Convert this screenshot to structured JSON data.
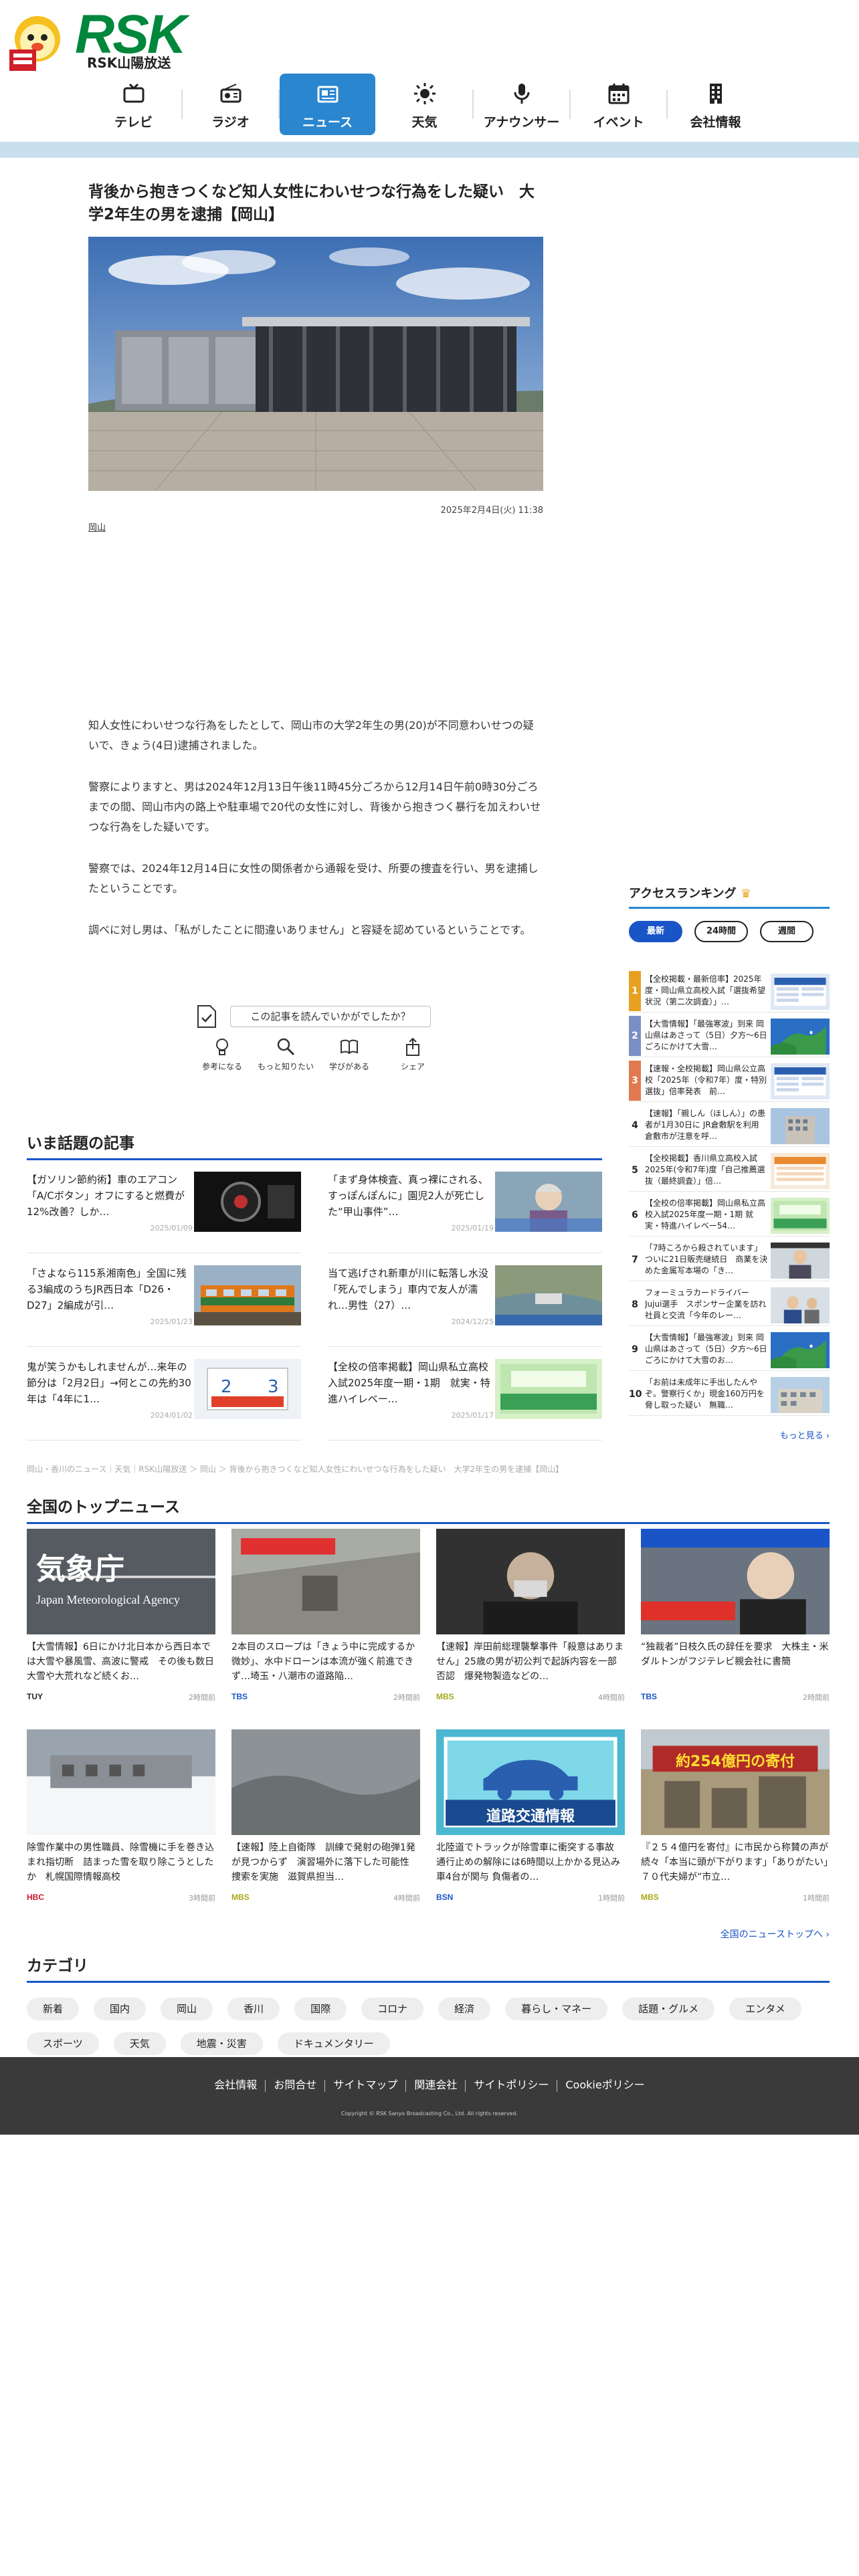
{
  "header": {
    "logo_text": "RSK",
    "logo_sub": "RSK山陽放送",
    "nav": [
      {
        "label": "テレビ",
        "icon": "tv-icon"
      },
      {
        "label": "ラジオ",
        "icon": "radio-icon"
      },
      {
        "label": "ニュース",
        "icon": "news-icon",
        "active": true
      },
      {
        "label": "天気",
        "icon": "sun-icon"
      },
      {
        "label": "アナウンサー",
        "icon": "microphone-icon"
      },
      {
        "label": "イベント",
        "icon": "calendar-icon"
      },
      {
        "label": "会社情報",
        "icon": "building-icon"
      }
    ]
  },
  "article": {
    "title": "背後から抱きつくなど知人女性にわいせつな行為をした疑い　大学2年生の男を逮捕【岡山】",
    "date": "2025年2月4日(火) 11:38",
    "tag": "岡山",
    "paragraphs": [
      "知人女性にわいせつな行為をしたとして、岡山市の大学2年生の男(20)が不同意わいせつの疑いで、きょう(4日)逮捕されました。",
      "警察によりますと、男は2024年12月13日午後11時45分ごろから12月14日午前0時30分ごろまでの間、岡山市内の路上や駐車場で20代の女性に対し、背後から抱きつく暴行を加えわいせつな行為をした疑いです。",
      "警察では、2024年12月14日に女性の関係者から通報を受け、所要の捜査を行い、男を逮捕したということです。",
      "調べに対し男は、「私がしたことに間違いありません」と容疑を認めているということです。"
    ],
    "feedback": {
      "question": "この記事を読んでいかがでしたか？",
      "options": [
        {
          "label": "参考になる",
          "icon": "lightbulb-icon"
        },
        {
          "label": "もっと知りたい",
          "icon": "magnifier-icon"
        },
        {
          "label": "学びがある",
          "icon": "book-icon"
        },
        {
          "label": "シェア",
          "icon": "share-icon"
        }
      ]
    }
  },
  "ranking": {
    "title": "アクセスランキング",
    "tabs": [
      "最新",
      "24時間",
      "週間"
    ],
    "active_tab": "最新",
    "items": [
      {
        "rank": "1",
        "text": "【全校掲載・最新倍率】2025年度・岡山県立高校入試「選抜希望状況（第二次調査）」…",
        "color": "#e8a020",
        "thumb": "blue-board"
      },
      {
        "rank": "2",
        "text": "【大雪情報】「最強寒波」到来 岡山県はあさって（5日）夕方〜6日ごろにかけて大雪…",
        "color": "#7b8fc4",
        "thumb": "map"
      },
      {
        "rank": "3",
        "text": "【速報・全校掲載】岡山県公立高校「2025年（令和7年）度・特別選抜」倍率発表　前…",
        "color": "#e07a50",
        "thumb": "blue-board"
      },
      {
        "rank": "4",
        "text": "【速報】「親しん（ほしん）」の患者が1月30日に JR倉敷駅を利用　倉敷市が注意を呼…",
        "color": "#ffffff",
        "thumb": "building"
      },
      {
        "rank": "5",
        "text": "【全校掲載】香川県立高校入試2025年(令和7年)度「自己推薦選抜（最終調査）」倍…",
        "color": "#ffffff",
        "thumb": "orange-board"
      },
      {
        "rank": "6",
        "text": "【全校の倍率掲載】岡山県私立高校入試2025年度一期・1期 就実・特進ハイレベー54…",
        "color": "#ffffff",
        "thumb": "green-board"
      },
      {
        "rank": "7",
        "text": "「7時ころから殺されています」ついに21日販売継続日　商業を決めた金属写本場の「き…",
        "color": "#ffffff",
        "thumb": "person"
      },
      {
        "rank": "8",
        "text": "フォーミュラカードライバー Jujui選手　スポンサー企業を訪れ社員と交流「今年のレー…",
        "color": "#ffffff",
        "thumb": "person2"
      },
      {
        "rank": "9",
        "text": "【大雪情報】「最強寒波」到来 岡山県はあさって（5日）夕方〜6日ごろにかけて大雪のお…",
        "color": "#ffffff",
        "thumb": "map"
      },
      {
        "rank": "10",
        "text": "「お前は未成年に手出したんやぞ。警察行くか」現金160万円を脅し取った疑い　無職…",
        "color": "#ffffff",
        "thumb": "building2"
      }
    ],
    "more": "もっと見る ›"
  },
  "trending": {
    "title": "いま話題の記事",
    "items": [
      {
        "text": "【ガソリン節約術】車のエアコン「A/Cボタン」オフにすると燃費が12%改善？しか…",
        "date": "2025/01/09",
        "thumb": "car"
      },
      {
        "text": "「まず身体検査、真っ裸にされる、すっぽんぽんに」園児2人が死亡した“甲山事件”…",
        "date": "2025/01/19",
        "thumb": "elder"
      },
      {
        "text": "「さよなら115系湘南色」全国に残る3編成のうちJR西日本「D26・D27」2編成が引…",
        "date": "2025/01/23",
        "thumb": "train"
      },
      {
        "text": "当て逃げされ新車が川に転落し水没「死んでしまう」車内で友人が濡れ…男性（27）…",
        "date": "2024/12/25",
        "thumb": "river"
      },
      {
        "text": "鬼が笑うかもしれませんが…来年の節分は「2月2日」→何とこの先約30年は「4年に1…",
        "date": "2024/01/02",
        "thumb": "calendar"
      },
      {
        "text": "【全校の倍率掲載】岡山県私立高校入試2025年度一期・1期　就実・特進ハイレベー…",
        "date": "2025/01/17",
        "thumb": "green-board"
      }
    ]
  },
  "breadcrumb": "岡山・香川のニュース｜天気｜RSK山陽放送 ＞ 岡山 ＞ 背後から抱きつくなど知人女性にわいせつな行為をした疑い　大学2年生の男を逮捕【岡山】",
  "national": {
    "title": "全国のトップニュース",
    "items": [
      {
        "text": "【大雪情報】6日にかけ北日本から西日本では大雪や暴風雪、高波に警戒　その後も数日大雪や大荒れなど続くお…",
        "source": "TUY",
        "source_color": "#222",
        "time": "2時間前",
        "img": "jma"
      },
      {
        "text": "2本目のスロープは「きょう中に完成するか微妙」、水中ドローンは本流が強く前進できず…埼玉・八潮市の道路陥…",
        "source": "TBS",
        "source_color": "#1a55c8",
        "time": "2時間前",
        "img": "aerial"
      },
      {
        "text": "【速報】岸田前総理襲撃事件「殺意はありません」25歳の男が初公判で起訴内容を一部否認　爆発物製造などの…",
        "source": "MBS",
        "source_color": "#a9a91a",
        "time": "4時間前",
        "img": "arrest"
      },
      {
        "text": "“独裁者”日枝久氏の辞任を要求　大株主・米ダルトンがフジテレビ親会社に書簡",
        "source": "TBS",
        "source_color": "#1a55c8",
        "time": "2時間前",
        "img": "interview"
      },
      {
        "text": "除雪作業中の男性職員、除雪機に手を巻き込まれ指切断　詰まった雪を取り除こうとしたか　札幌国際情報高校",
        "source": "HBC",
        "source_color": "#c81a2a",
        "time": "3時間前",
        "img": "snow"
      },
      {
        "text": "【速報】陸上自衛隊　訓練で発射の砲弾1発が見つからず　演習場外に落下した可能性　捜索を実施　滋賀県担当…",
        "source": "MBS",
        "source_color": "#a9a91a",
        "time": "4時間前",
        "img": "hills"
      },
      {
        "text": "北陸道でトラックが除雪車に衝突する事故　通行止めの解除には6時間以上かかる見込み　車4台が関与 負傷者の…",
        "source": "BSN",
        "source_color": "#1a55c8",
        "time": "1時間前",
        "img": "road"
      },
      {
        "text": "『２５４億円を寄付』に市民から称賛の声が続々「本当に頭が下がります」「ありがたい」７０代夫婦が“市立…",
        "source": "MBS",
        "source_color": "#a9a91a",
        "time": "1時間前",
        "img": "city"
      }
    ],
    "more": "全国のニューストップへ ›",
    "road_label": "道路交通情報",
    "jma_jp": "気象庁",
    "jma_en": "Japan Meteorological Agency",
    "city_banner": "約254億円の寄付"
  },
  "category": {
    "title": "カテゴリ",
    "items": [
      "新着",
      "国内",
      "岡山",
      "香川",
      "国際",
      "コロナ",
      "経済",
      "暮らし・マネー",
      "話題・グルメ",
      "エンタメ",
      "スポーツ",
      "天気",
      "地震・災害",
      "ドキュメンタリー"
    ]
  },
  "footer": {
    "links": [
      "会社情報",
      "お問合せ",
      "サイトマップ",
      "関連会社",
      "サイトポリシー",
      "Cookieポリシー"
    ],
    "copyright": "Copyright © RSK Sanyo Broadcasting Co., Ltd. All rights reserved."
  },
  "colors": {
    "accent": "#2a86cf",
    "brand": "#00873c",
    "link": "#1a55c8"
  }
}
